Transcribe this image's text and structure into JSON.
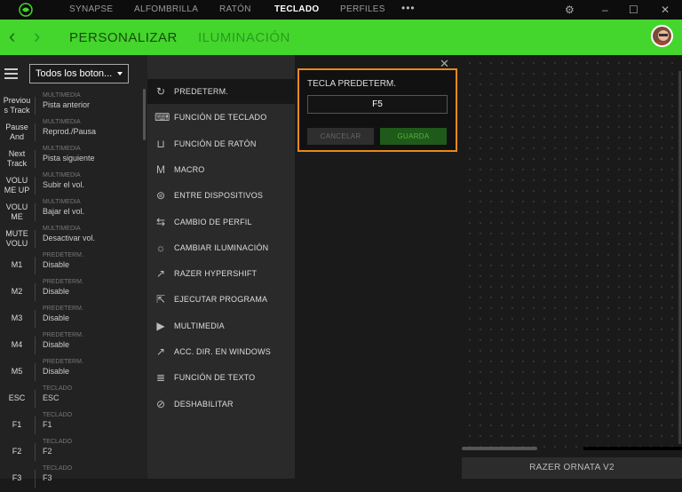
{
  "titlebar": {
    "tabs": [
      {
        "label": "SYNAPSE"
      },
      {
        "label": "ALFOMBRILLA"
      },
      {
        "label": "RATÓN"
      },
      {
        "label": "TECLADO"
      },
      {
        "label": "PERFILES"
      }
    ],
    "active_tab": "TECLADO",
    "more": "•••",
    "settings_icon": "⚙",
    "minimize_icon": "–",
    "maximize_icon": "☐",
    "close_icon": "✕"
  },
  "header": {
    "back": "‹",
    "forward": "›",
    "tabs": [
      {
        "label": "PERSONALIZAR"
      },
      {
        "label": "ILUMINACIÓN"
      }
    ],
    "accent": "#44d62c"
  },
  "filter": {
    "value": "Todos los boton..."
  },
  "keys": [
    {
      "key": "Previou\ns Track",
      "category": "MULTIMEDIA",
      "action": "Pista anterior"
    },
    {
      "key": "Pause\nAnd",
      "category": "MULTIMEDIA",
      "action": "Reprod./Pausa"
    },
    {
      "key": "Next\nTrack",
      "category": "MULTIMEDIA",
      "action": "Pista siguiente"
    },
    {
      "key": "VOLU\nME UP",
      "category": "MULTIMEDIA",
      "action": "Subir el vol."
    },
    {
      "key": "VOLU\nME",
      "category": "MULTIMEDIA",
      "action": "Bajar el vol."
    },
    {
      "key": "MUTE\nVOLU",
      "category": "MULTIMEDIA",
      "action": "Desactivar vol."
    },
    {
      "key": "M1",
      "category": "PREDETERM.",
      "action": "Disable"
    },
    {
      "key": "M2",
      "category": "PREDETERM.",
      "action": "Disable"
    },
    {
      "key": "M3",
      "category": "PREDETERM.",
      "action": "Disable"
    },
    {
      "key": "M4",
      "category": "PREDETERM.",
      "action": "Disable"
    },
    {
      "key": "M5",
      "category": "PREDETERM.",
      "action": "Disable"
    },
    {
      "key": "ESC",
      "category": "TECLADO",
      "action": "ESC"
    },
    {
      "key": "F1",
      "category": "TECLADO",
      "action": "F1"
    },
    {
      "key": "F2",
      "category": "TECLADO",
      "action": "F2"
    },
    {
      "key": "F3",
      "category": "TECLADO",
      "action": "F3"
    }
  ],
  "functions": [
    {
      "label": "PREDETERM.",
      "icon": "↻",
      "selected": true
    },
    {
      "label": "FUNCIÓN DE TECLADO",
      "icon": "⌨"
    },
    {
      "label": "FUNCIÓN DE RATÓN",
      "icon": "⊔"
    },
    {
      "label": "MACRO",
      "icon": "M"
    },
    {
      "label": "ENTRE DISPOSITIVOS",
      "icon": "⊜"
    },
    {
      "label": "CAMBIO DE PERFIL",
      "icon": "⇆"
    },
    {
      "label": "CAMBIAR ILUMINACIÓN",
      "icon": "☼"
    },
    {
      "label": "RAZER HYPERSHIFT",
      "icon": "↗"
    },
    {
      "label": "EJECUTAR PROGRAMA",
      "icon": "⇱"
    },
    {
      "label": "MULTIMEDIA",
      "icon": "▶"
    },
    {
      "label": "ACC. DIR. EN WINDOWS",
      "icon": "↗"
    },
    {
      "label": "FUNCIÓN DE TEXTO",
      "icon": "≣"
    },
    {
      "label": "DESHABILITAR",
      "icon": "⊘"
    }
  ],
  "dialog": {
    "close": "✕",
    "title": "TECLA PREDETERM.",
    "value": "F5",
    "cancel": "CANCELAR",
    "save": "GUARDA",
    "border_color": "#e88a1a"
  },
  "device": {
    "name": "RAZER ORNATA V2"
  }
}
